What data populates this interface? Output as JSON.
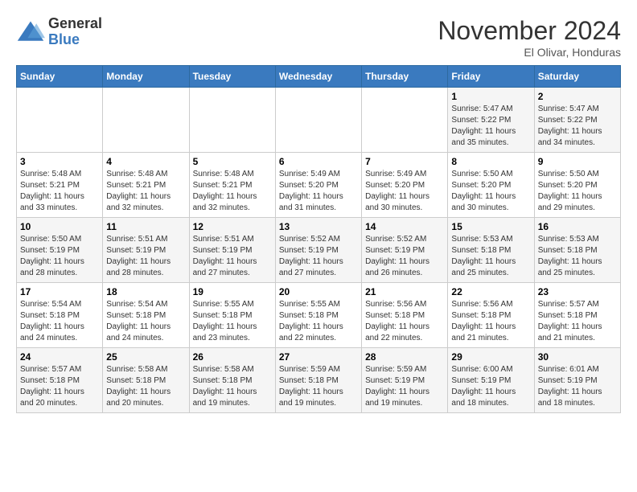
{
  "header": {
    "logo": {
      "general": "General",
      "blue": "Blue"
    },
    "title": "November 2024",
    "subtitle": "El Olivar, Honduras"
  },
  "weekdays": [
    "Sunday",
    "Monday",
    "Tuesday",
    "Wednesday",
    "Thursday",
    "Friday",
    "Saturday"
  ],
  "weeks": [
    [
      {
        "day": "",
        "info": ""
      },
      {
        "day": "",
        "info": ""
      },
      {
        "day": "",
        "info": ""
      },
      {
        "day": "",
        "info": ""
      },
      {
        "day": "",
        "info": ""
      },
      {
        "day": "1",
        "info": "Sunrise: 5:47 AM\nSunset: 5:22 PM\nDaylight: 11 hours and 35 minutes."
      },
      {
        "day": "2",
        "info": "Sunrise: 5:47 AM\nSunset: 5:22 PM\nDaylight: 11 hours and 34 minutes."
      }
    ],
    [
      {
        "day": "3",
        "info": "Sunrise: 5:48 AM\nSunset: 5:21 PM\nDaylight: 11 hours and 33 minutes."
      },
      {
        "day": "4",
        "info": "Sunrise: 5:48 AM\nSunset: 5:21 PM\nDaylight: 11 hours and 32 minutes."
      },
      {
        "day": "5",
        "info": "Sunrise: 5:48 AM\nSunset: 5:21 PM\nDaylight: 11 hours and 32 minutes."
      },
      {
        "day": "6",
        "info": "Sunrise: 5:49 AM\nSunset: 5:20 PM\nDaylight: 11 hours and 31 minutes."
      },
      {
        "day": "7",
        "info": "Sunrise: 5:49 AM\nSunset: 5:20 PM\nDaylight: 11 hours and 30 minutes."
      },
      {
        "day": "8",
        "info": "Sunrise: 5:50 AM\nSunset: 5:20 PM\nDaylight: 11 hours and 30 minutes."
      },
      {
        "day": "9",
        "info": "Sunrise: 5:50 AM\nSunset: 5:20 PM\nDaylight: 11 hours and 29 minutes."
      }
    ],
    [
      {
        "day": "10",
        "info": "Sunrise: 5:50 AM\nSunset: 5:19 PM\nDaylight: 11 hours and 28 minutes."
      },
      {
        "day": "11",
        "info": "Sunrise: 5:51 AM\nSunset: 5:19 PM\nDaylight: 11 hours and 28 minutes."
      },
      {
        "day": "12",
        "info": "Sunrise: 5:51 AM\nSunset: 5:19 PM\nDaylight: 11 hours and 27 minutes."
      },
      {
        "day": "13",
        "info": "Sunrise: 5:52 AM\nSunset: 5:19 PM\nDaylight: 11 hours and 27 minutes."
      },
      {
        "day": "14",
        "info": "Sunrise: 5:52 AM\nSunset: 5:19 PM\nDaylight: 11 hours and 26 minutes."
      },
      {
        "day": "15",
        "info": "Sunrise: 5:53 AM\nSunset: 5:18 PM\nDaylight: 11 hours and 25 minutes."
      },
      {
        "day": "16",
        "info": "Sunrise: 5:53 AM\nSunset: 5:18 PM\nDaylight: 11 hours and 25 minutes."
      }
    ],
    [
      {
        "day": "17",
        "info": "Sunrise: 5:54 AM\nSunset: 5:18 PM\nDaylight: 11 hours and 24 minutes."
      },
      {
        "day": "18",
        "info": "Sunrise: 5:54 AM\nSunset: 5:18 PM\nDaylight: 11 hours and 24 minutes."
      },
      {
        "day": "19",
        "info": "Sunrise: 5:55 AM\nSunset: 5:18 PM\nDaylight: 11 hours and 23 minutes."
      },
      {
        "day": "20",
        "info": "Sunrise: 5:55 AM\nSunset: 5:18 PM\nDaylight: 11 hours and 22 minutes."
      },
      {
        "day": "21",
        "info": "Sunrise: 5:56 AM\nSunset: 5:18 PM\nDaylight: 11 hours and 22 minutes."
      },
      {
        "day": "22",
        "info": "Sunrise: 5:56 AM\nSunset: 5:18 PM\nDaylight: 11 hours and 21 minutes."
      },
      {
        "day": "23",
        "info": "Sunrise: 5:57 AM\nSunset: 5:18 PM\nDaylight: 11 hours and 21 minutes."
      }
    ],
    [
      {
        "day": "24",
        "info": "Sunrise: 5:57 AM\nSunset: 5:18 PM\nDaylight: 11 hours and 20 minutes."
      },
      {
        "day": "25",
        "info": "Sunrise: 5:58 AM\nSunset: 5:18 PM\nDaylight: 11 hours and 20 minutes."
      },
      {
        "day": "26",
        "info": "Sunrise: 5:58 AM\nSunset: 5:18 PM\nDaylight: 11 hours and 19 minutes."
      },
      {
        "day": "27",
        "info": "Sunrise: 5:59 AM\nSunset: 5:18 PM\nDaylight: 11 hours and 19 minutes."
      },
      {
        "day": "28",
        "info": "Sunrise: 5:59 AM\nSunset: 5:19 PM\nDaylight: 11 hours and 19 minutes."
      },
      {
        "day": "29",
        "info": "Sunrise: 6:00 AM\nSunset: 5:19 PM\nDaylight: 11 hours and 18 minutes."
      },
      {
        "day": "30",
        "info": "Sunrise: 6:01 AM\nSunset: 5:19 PM\nDaylight: 11 hours and 18 minutes."
      }
    ]
  ]
}
